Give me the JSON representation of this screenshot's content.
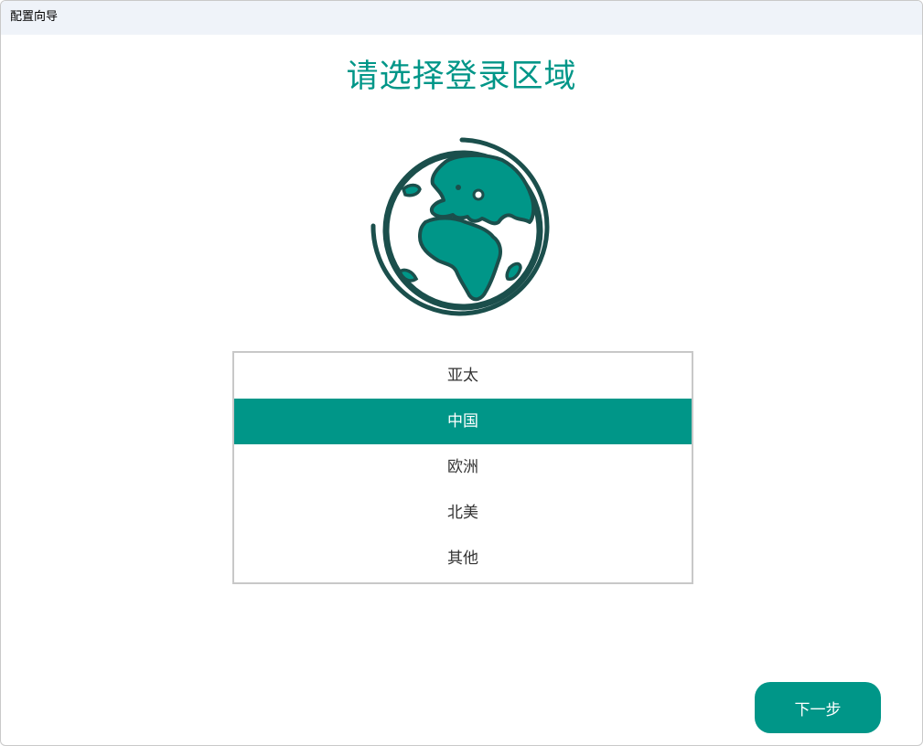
{
  "window": {
    "title": "配置向导"
  },
  "page": {
    "heading": "请选择登录区域"
  },
  "globe_icon": {
    "icon": "globe-icon",
    "fill_color": "#009688",
    "stroke_color": "#1b4f4c"
  },
  "regions": {
    "selected_index": 1,
    "items": [
      {
        "label": "亚太"
      },
      {
        "label": "中国"
      },
      {
        "label": "欧洲"
      },
      {
        "label": "北美"
      },
      {
        "label": "其他"
      }
    ]
  },
  "footer": {
    "next_label": "下一步"
  },
  "colors": {
    "accent": "#009688",
    "titlebar_bg": "#eff3f9",
    "list_border": "#c8c8c8"
  }
}
